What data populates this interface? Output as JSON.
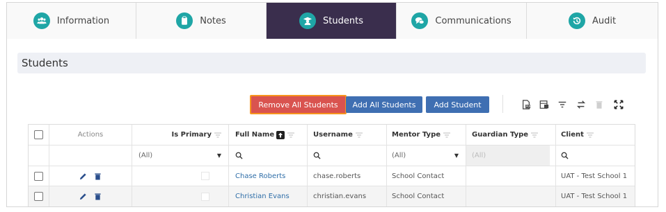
{
  "tabs": [
    {
      "label": "Information",
      "icon": "users-icon",
      "active": false
    },
    {
      "label": "Notes",
      "icon": "clipboard-icon",
      "active": false
    },
    {
      "label": "Students",
      "icon": "graduate-icon",
      "active": true
    },
    {
      "label": "Communications",
      "icon": "chat-icon",
      "active": false
    },
    {
      "label": "Audit",
      "icon": "history-icon",
      "active": false
    }
  ],
  "section": {
    "title": "Students"
  },
  "toolbar": {
    "remove_all_label": "Remove All Students",
    "add_all_label": "Add All Students",
    "add_label": "Add Student"
  },
  "grid": {
    "columns": [
      "",
      "Actions",
      "Is Primary",
      "Full Name",
      "Username",
      "Mentor Type",
      "Guardian Type",
      "Client"
    ],
    "filters": {
      "is_primary": "(All)",
      "mentor_type": "(All)",
      "guardian_type": "(All)"
    },
    "rows": [
      {
        "full_name": "Chase Roberts",
        "username": "chase.roberts",
        "mentor_type": "School Contact",
        "guardian_type": "",
        "client": "UAT - Test School 1"
      },
      {
        "full_name": "Christian Evans",
        "username": "christian.evans",
        "mentor_type": "School Contact",
        "guardian_type": "",
        "client": "UAT - Test School 1"
      }
    ]
  },
  "colors": {
    "active_tab": "#3a2e4d",
    "icon_teal": "#1fa6a6",
    "remove_button": "#d9534f",
    "remove_highlight": "#f7941d",
    "primary_button": "#3f6fb2",
    "link": "#2f6ea8"
  }
}
